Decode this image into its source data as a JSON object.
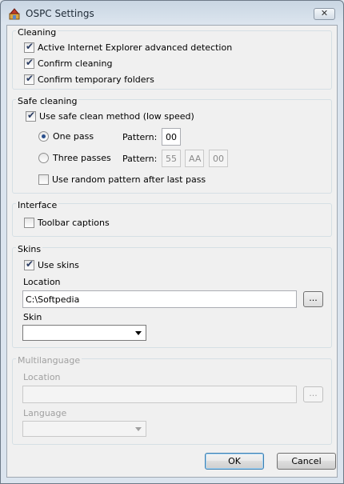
{
  "window": {
    "title": "OSPC Settings",
    "close_glyph": "✕"
  },
  "cleaning": {
    "title": "Cleaning",
    "items": [
      {
        "label": "Active Internet Explorer advanced detection",
        "checked": true
      },
      {
        "label": "Confirm cleaning",
        "checked": true
      },
      {
        "label": "Confirm temporary folders",
        "checked": true
      }
    ]
  },
  "safe_cleaning": {
    "title": "Safe cleaning",
    "use_safe_label": "Use safe clean method (low speed)",
    "use_safe_checked": true,
    "one_pass_label": "One pass",
    "one_pass_selected": true,
    "three_passes_label": "Three passes",
    "pattern_label": "Pattern:",
    "one_pass_pattern": "00",
    "three_pass_patterns": [
      "55",
      "AA",
      "00"
    ],
    "random_label": "Use random pattern after last pass",
    "random_checked": false
  },
  "interface": {
    "title": "Interface",
    "toolbar_captions_label": "Toolbar captions",
    "toolbar_captions_checked": false
  },
  "skins": {
    "title": "Skins",
    "use_skins_label": "Use skins",
    "use_skins_checked": true,
    "location_label": "Location",
    "location_value": "C:\\Softpedia",
    "browse_label": "...",
    "skin_label": "Skin",
    "skin_value": ""
  },
  "multilanguage": {
    "title": "Multilanguage",
    "location_label": "Location",
    "location_value": "",
    "browse_label": "...",
    "language_label": "Language",
    "language_value": ""
  },
  "buttons": {
    "ok": "OK",
    "cancel": "Cancel"
  },
  "icons": {
    "app": "ospc-app-icon",
    "close": "close-icon",
    "dropdown": "chevron-down-icon"
  }
}
